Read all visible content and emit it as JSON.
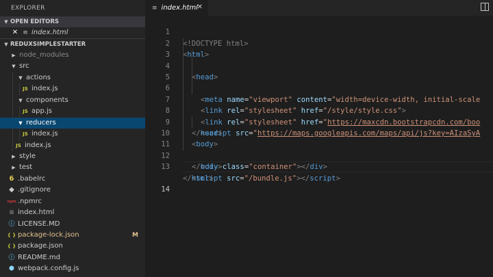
{
  "sidebar": {
    "title": "EXPLORER",
    "open_editors_label": "OPEN EDITORS",
    "open_editors": [
      {
        "name": "index.html"
      }
    ],
    "project_label": "REDUXSIMPLESTARTER",
    "tree": {
      "node_modules": "node_modules",
      "src": "src",
      "actions": "actions",
      "actions_index": "index.js",
      "components": "components",
      "app": "app.js",
      "reducers": "reducers",
      "reducers_index": "index.js",
      "src_index": "index.js",
      "style": "style",
      "test": "test",
      "babelrc": ".babelrc",
      "gitignore": ".gitignore",
      "npmrc": ".npmrc",
      "index_html": "index.html",
      "license": "LICENSE.MD",
      "package_lock": "package-lock.json",
      "package_lock_badge": "M",
      "package_json": "package.json",
      "readme": "README.md",
      "webpack": "webpack.config.js"
    },
    "icons": {
      "js": "JS",
      "json": "{ }",
      "npm": "npm"
    }
  },
  "editor": {
    "tab": {
      "name": "index.html"
    },
    "line_numbers": [
      "1",
      "2",
      "3",
      "4",
      "5",
      "6",
      "7",
      "8",
      "9",
      "10",
      "11",
      "12",
      "13",
      "14"
    ],
    "code": {
      "l1": {
        "a": "<!DOCTYPE html>"
      },
      "l2": {
        "open": "<",
        "tag": "html",
        "close": ">"
      },
      "l3": {
        "open": "<",
        "tag": "head",
        "close": ">"
      },
      "l4": {
        "open": "<",
        "tag": "meta",
        "attr1": "name",
        "eq": "=",
        "val1": "\"viewport\"",
        "attr2": "content",
        "val2": "\"width=device-width, initial-scale"
      },
      "l5": {
        "open": "<",
        "tag": "link",
        "attr1": "rel",
        "val1": "\"stylesheet\"",
        "attr2": "href",
        "val2": "\"/style/style.css\"",
        "close": ">"
      },
      "l6": {
        "open": "<",
        "tag": "link",
        "attr1": "rel",
        "val1": "\"stylesheet\"",
        "attr2": "href",
        "q": "\"",
        "url": "https://maxcdn.bootstrapcdn.com/boo"
      },
      "l7": {
        "open": "<",
        "tag": "script",
        "attr1": "src",
        "q": "\"",
        "url": "https://maps.googleapis.com/maps/api/js?key=AIzaSyA"
      },
      "l8": {
        "open": "</",
        "tag": "head",
        "close": ">"
      },
      "l9": {
        "open": "<",
        "tag": "body",
        "close": ">"
      },
      "l10": {
        "open": "<",
        "tag": "div",
        "attr1": "class",
        "val1": "\"container\"",
        "mid": "></",
        "tag2": "div",
        "close": ">"
      },
      "l11": {
        "open": "</",
        "tag": "body",
        "close": ">"
      },
      "l12": {
        "open": "<",
        "tag": "script",
        "attr1": "src",
        "val1": "\"/bundle.js\"",
        "mid": "></",
        "tag2": "script",
        "close": ">"
      },
      "l13": {
        "open": "</",
        "tag": "html",
        "close": ">"
      }
    }
  }
}
